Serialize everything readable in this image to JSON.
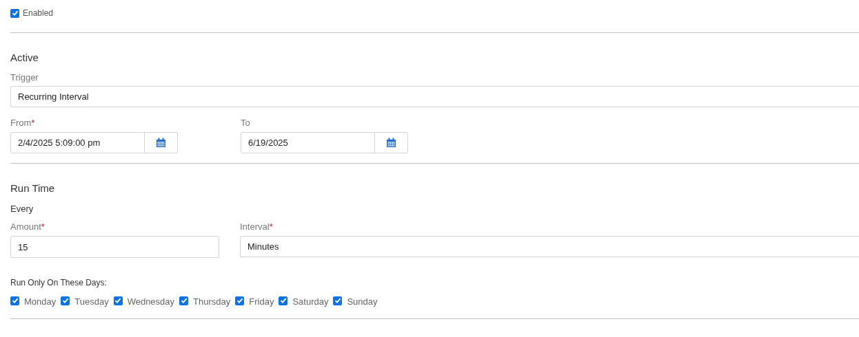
{
  "enabled": {
    "label": "Enabled",
    "checked": true
  },
  "active": {
    "heading": "Active",
    "trigger": {
      "label": "Trigger",
      "value": "Recurring Interval"
    },
    "from": {
      "label": "From",
      "required_mark": "*",
      "value": "2/4/2025 5:09:00 pm"
    },
    "to": {
      "label": "To",
      "value": "6/19/2025"
    }
  },
  "run_time": {
    "heading": "Run Time",
    "subheading": "Every",
    "amount": {
      "label": "Amount",
      "required_mark": "*",
      "value": "15"
    },
    "interval": {
      "label": "Interval",
      "required_mark": "*",
      "value": "Minutes"
    },
    "days_label": "Run Only On These Days:",
    "days": [
      {
        "label": "Monday",
        "checked": true
      },
      {
        "label": "Tuesday",
        "checked": true
      },
      {
        "label": "Wednesday",
        "checked": true
      },
      {
        "label": "Thursday",
        "checked": true
      },
      {
        "label": "Friday",
        "checked": true
      },
      {
        "label": "Saturday",
        "checked": true
      },
      {
        "label": "Sunday",
        "checked": true
      }
    ]
  }
}
